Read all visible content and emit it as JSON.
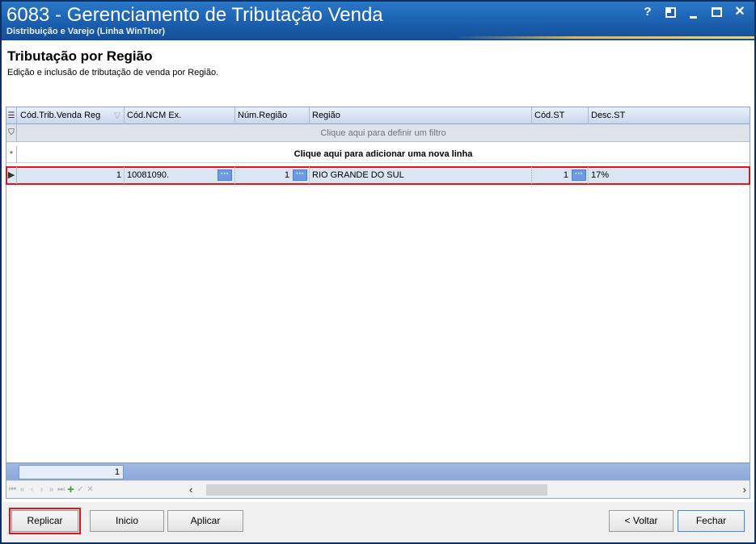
{
  "window": {
    "title": "6083 - Gerenciamento de Tributação Venda",
    "subtitle": "Distribuição e Varejo (Linha WinThor)",
    "controls": {
      "help": "?",
      "close": "✕"
    }
  },
  "header": {
    "title": "Tributação por Região",
    "description": "Edição e inclusão de tributação de venda por Região."
  },
  "grid": {
    "columns": [
      "Cód.Trib.Venda Reg",
      "Cód.NCM Ex.",
      "Núm.Região",
      "Região",
      "Cód.ST",
      "Desc.ST"
    ],
    "filter_text": "Clique aqui para definir um filtro",
    "new_row_text": "Clique aqui para adicionar uma nova linha",
    "rows": [
      {
        "cod_trib": "1",
        "ncm": "10081090.",
        "num_regiao": "1",
        "regiao": "RIO GRANDE DO SUL",
        "cod_st": "1",
        "desc_st": "17%"
      }
    ],
    "footer_total": "1"
  },
  "buttons": {
    "replicar": "Replicar",
    "inicio": "Inicio",
    "aplicar": "Aplicar",
    "voltar": "< Voltar",
    "fechar": "Fechar"
  },
  "colors": {
    "titlebar": "#1b5fae",
    "highlight": "#e2141b",
    "selected_row": "#dbe6f5"
  }
}
